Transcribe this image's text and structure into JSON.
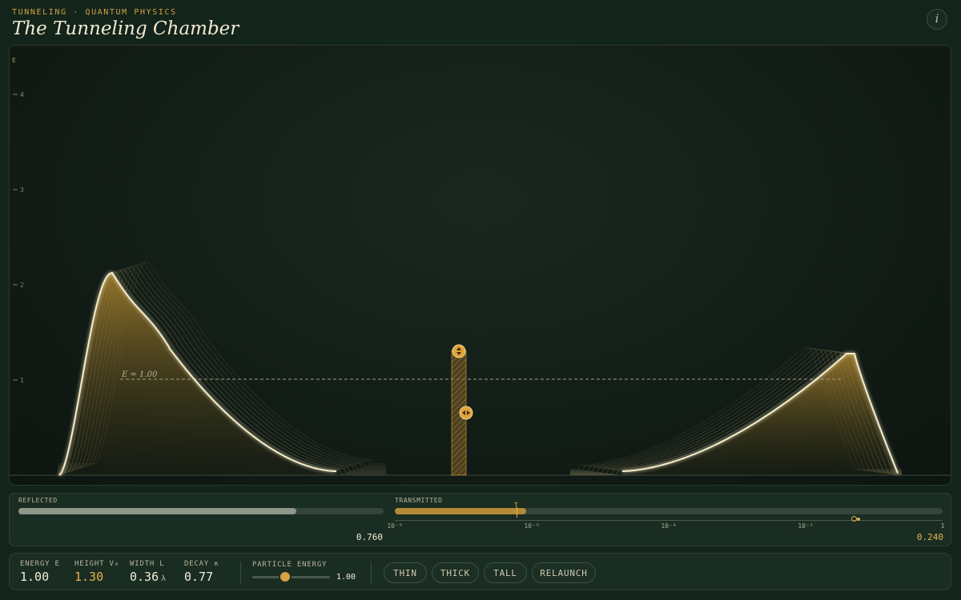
{
  "header": {
    "eyebrow": "TUNNELING · QUANTUM PHYSICS",
    "title": "The Tunneling Chamber",
    "info_glyph": "i",
    "info_icon": "info-icon"
  },
  "chamber": {
    "axis_label": "E",
    "y_ticks": [
      "4",
      "3",
      "2",
      "1"
    ],
    "energy_label": "E = 1.00",
    "barrier_handles": [
      "height-handle",
      "width-handle"
    ],
    "colors": {
      "accent": "#d4a243",
      "wave": "#f5eac6",
      "barrier": "#c0913a"
    }
  },
  "meter": {
    "reflected_label": "REFLECTED",
    "transmitted_label": "TRANSMITTED",
    "reflected_value": "0.760",
    "transmitted_value": "0.240",
    "reflected_fraction": 0.76,
    "transmitted_fraction": 0.24,
    "log_ticks": [
      "10⁻⁸",
      "10⁻⁶",
      "10⁻⁴",
      "10⁻²",
      "1"
    ],
    "marker_glyph": "T"
  },
  "controls": {
    "readouts": [
      {
        "label": "ENERGY E",
        "value": "1.00",
        "unit": "",
        "color": "#f1ecd8"
      },
      {
        "label": "HEIGHT V₀",
        "value": "1.30",
        "unit": "",
        "color": "#e8b04d"
      },
      {
        "label": "WIDTH L",
        "value": "0.36",
        "unit": "λ",
        "color": "#f1ecd8"
      },
      {
        "label": "DECAY κ",
        "value": "0.77",
        "unit": "",
        "color": "#f1ecd8"
      }
    ],
    "slider": {
      "label": "PARTICLE ENERGY",
      "value": "1.00",
      "fraction": 0.42
    },
    "buttons": [
      "THIN",
      "THICK",
      "TALL",
      "RELAUNCH"
    ]
  }
}
